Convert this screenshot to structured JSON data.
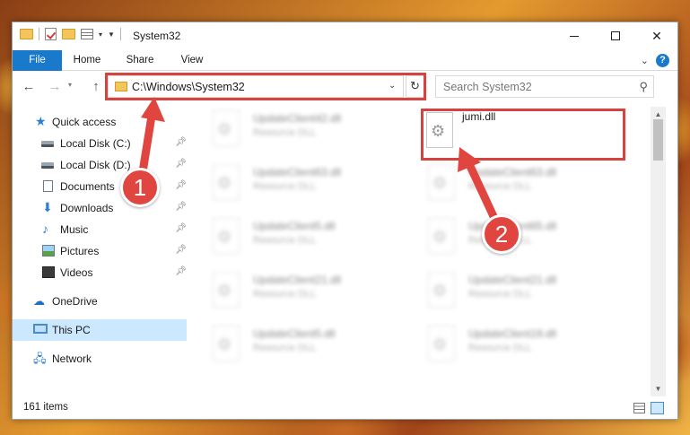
{
  "window": {
    "title": "System32"
  },
  "ribbon": {
    "tabs": [
      "File",
      "Home",
      "Share",
      "View"
    ]
  },
  "navbar": {
    "address": "C:\\Windows\\System32",
    "search_placeholder": "Search System32"
  },
  "sidebar": {
    "items": [
      {
        "label": "Quick access"
      },
      {
        "label": "Local Disk (C:)"
      },
      {
        "label": "Local Disk (D:)"
      },
      {
        "label": "Documents"
      },
      {
        "label": "Downloads"
      },
      {
        "label": "Music"
      },
      {
        "label": "Pictures"
      },
      {
        "label": "Videos"
      },
      {
        "label": "OneDrive"
      },
      {
        "label": "This PC"
      },
      {
        "label": "Network"
      }
    ]
  },
  "files": {
    "col1": [
      {
        "name": "UpdateClient42.dll",
        "type": "Resource DLL"
      },
      {
        "name": "UpdateClient63.dll",
        "type": "Resource DLL"
      },
      {
        "name": "UpdateClient5.dll",
        "type": "Resource DLL"
      },
      {
        "name": "UpdateClient21.dll",
        "type": "Resource DLL"
      },
      {
        "name": "UpdateClient5.dll",
        "type": "Resource DLL"
      }
    ],
    "col2": [
      {
        "name": "jumi.dll",
        "type": ""
      },
      {
        "name": "UpdateClient63.dll",
        "type": "Resource DLL"
      },
      {
        "name": "UpdateClient65.dll",
        "type": "Resource DLL"
      },
      {
        "name": "UpdateClient21.dll",
        "type": "Resource DLL"
      },
      {
        "name": "UpdateClient19.dll",
        "type": "Resource DLL"
      }
    ]
  },
  "status": {
    "item_count": "161 items"
  },
  "annotations": {
    "step1": "1",
    "step2": "2",
    "color": "#e0463f"
  }
}
